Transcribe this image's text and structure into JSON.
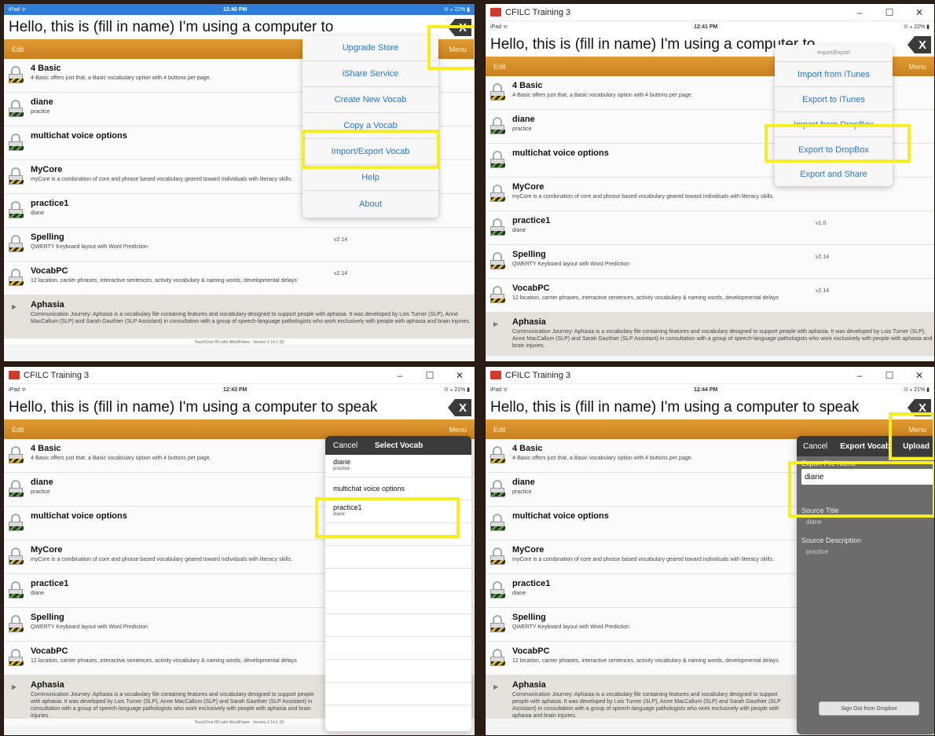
{
  "app": {
    "message_short": "Hello, this is (fill in name) I'm using a computer to",
    "message_full": "Hello, this is (fill in name) I'm using a computer to speak",
    "close_label": "X",
    "edit_label": "Edit",
    "menu_label": "Menu",
    "footer": "TouchChat HD with WordPower - Version 2.14.1 (0)"
  },
  "window_title": "CFILC Training 3",
  "window_buttons": {
    "minimize": "–",
    "maximize": "☐",
    "close": "✕"
  },
  "status": {
    "p1": {
      "left": "iPad ᯤ",
      "time": "12:40 PM",
      "right": "⊙ ⁎ 22% ▮"
    },
    "p2": {
      "left": "iPad ᯤ",
      "time": "12:41 PM",
      "right": "⊙ ⁎ 22% ▮"
    },
    "p3": {
      "left": "iPad ᯤ",
      "time": "12:43 PM",
      "right": "⊙ ⁎ 21% ▮"
    },
    "p4": {
      "left": "iPad ᯤ",
      "time": "12:44 PM",
      "right": "⊙ ⁎ 21% ▮"
    }
  },
  "vocabs": [
    {
      "name": "4 Basic",
      "desc": "4-Basic offers just that, a Basic vocabulary option with 4 buttons per page.",
      "version": ""
    },
    {
      "name": "diane",
      "desc": "practice",
      "version": ""
    },
    {
      "name": "multichat voice options",
      "desc": "",
      "version": ""
    },
    {
      "name": "MyCore",
      "desc": "myCore is a combination of core and phrase based vocabulary geared toward individuals with literacy skills.",
      "version": ""
    },
    {
      "name": "practice1",
      "desc": "diane",
      "version": "v1.0"
    },
    {
      "name": "Spelling",
      "desc": "QWERTY Keyboard layout with Word Prediction",
      "version": "v2.14"
    },
    {
      "name": "VocabPC",
      "desc": "12 location, carrier phrases, interactive sentences, activity vocabulary & naming words, developmental delays",
      "version": "v2.14"
    },
    {
      "name": "Aphasia",
      "desc": "Communication Journey: Aphasia is a vocabulary file containing features and vocabulary designed to support people with aphasia. It was developed by Lois Turner (SLP), Anne MacCallum (SLP) and Sarah Gauthier (SLP Assistant) in consultation with a group of speech-language pathologists who work exclusively with people with aphasia and brain injuries.",
      "version": ""
    }
  ],
  "menu": [
    "Upgrade Store",
    "iShare Service",
    "Create New Vocab",
    "Copy a Vocab",
    "Import/Export Vocab",
    "Help",
    "About"
  ],
  "import_export": {
    "title": "Import/Export",
    "items": [
      "Import from iTunes",
      "Export to iTunes",
      "Import from DropBox",
      "Export to DropBox",
      "Export and Share"
    ]
  },
  "select_vocab": {
    "cancel": "Cancel",
    "title": "Select Vocab",
    "rows": [
      {
        "name": "diane",
        "desc": "practice"
      },
      {
        "name": "multichat voice options",
        "desc": ""
      },
      {
        "name": "practice1",
        "desc": "diane"
      }
    ]
  },
  "export_vocab": {
    "cancel": "Cancel",
    "title": "Export Vocab",
    "upload": "Upload",
    "file_name_label": "Export File Name",
    "file_name_value": "diane",
    "source_title_label": "Source Title",
    "source_title_value": "diane",
    "source_desc_label": "Source Description",
    "source_desc_value": "practice",
    "sign_out": "Sign Out from Dropbox"
  }
}
